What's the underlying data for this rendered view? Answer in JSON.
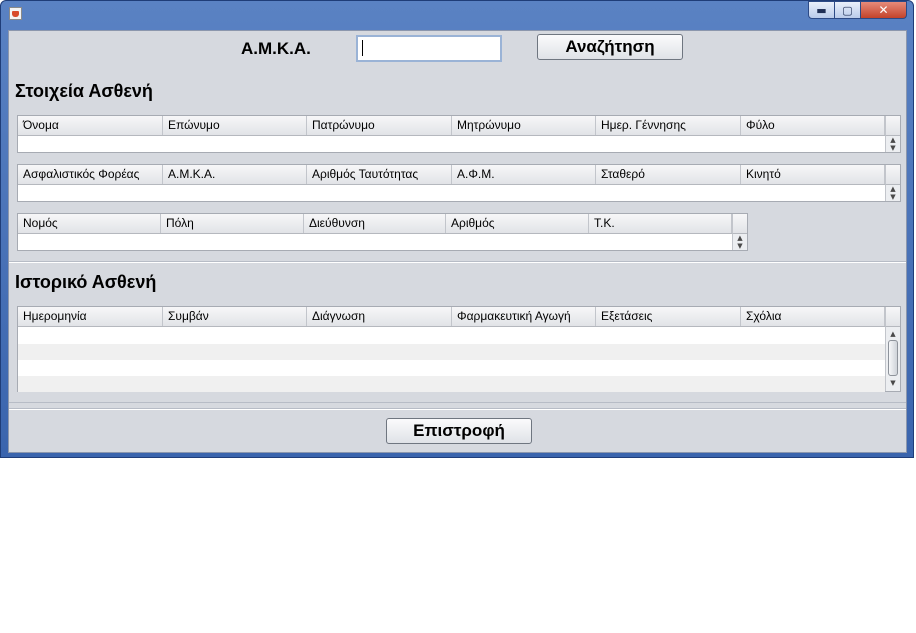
{
  "window": {
    "icon": "java-cup-icon",
    "controls": {
      "minimize": "▬",
      "maximize": "▢",
      "close": "✕"
    }
  },
  "search": {
    "label": "Α.Μ.Κ.Α.",
    "value": "",
    "button": "Αναζήτηση"
  },
  "patient_info": {
    "title": "Στοιχεία Ασθενή",
    "table1": {
      "columns": [
        "Όνομα",
        "Επώνυμο",
        "Πατρώνυμο",
        "Μητρώνυμο",
        "Ημερ. Γέννησης",
        "Φύλο"
      ]
    },
    "table2": {
      "columns": [
        "Ασφαλιστικός Φορέας",
        "Α.Μ.Κ.Α.",
        "Αριθμός Ταυτότητας",
        "Α.Φ.Μ.",
        "Σταθερό",
        "Κινητό"
      ]
    },
    "table3": {
      "columns": [
        "Νομός",
        "Πόλη",
        "Διεύθυνση",
        "Αριθμός",
        "Τ.Κ."
      ]
    }
  },
  "history": {
    "title": "Ιστορικό Ασθενή",
    "columns": [
      "Ημερομηνία",
      "Συμβάν",
      "Διάγνωση",
      "Φαρμακευτική Αγωγή",
      "Εξετάσεις",
      "Σχόλια"
    ]
  },
  "footer": {
    "back_button": "Επιστροφή"
  },
  "colors": {
    "titlebar": "#4a74bb",
    "panel": "#d6d9df",
    "header": "#e8e9ec"
  }
}
